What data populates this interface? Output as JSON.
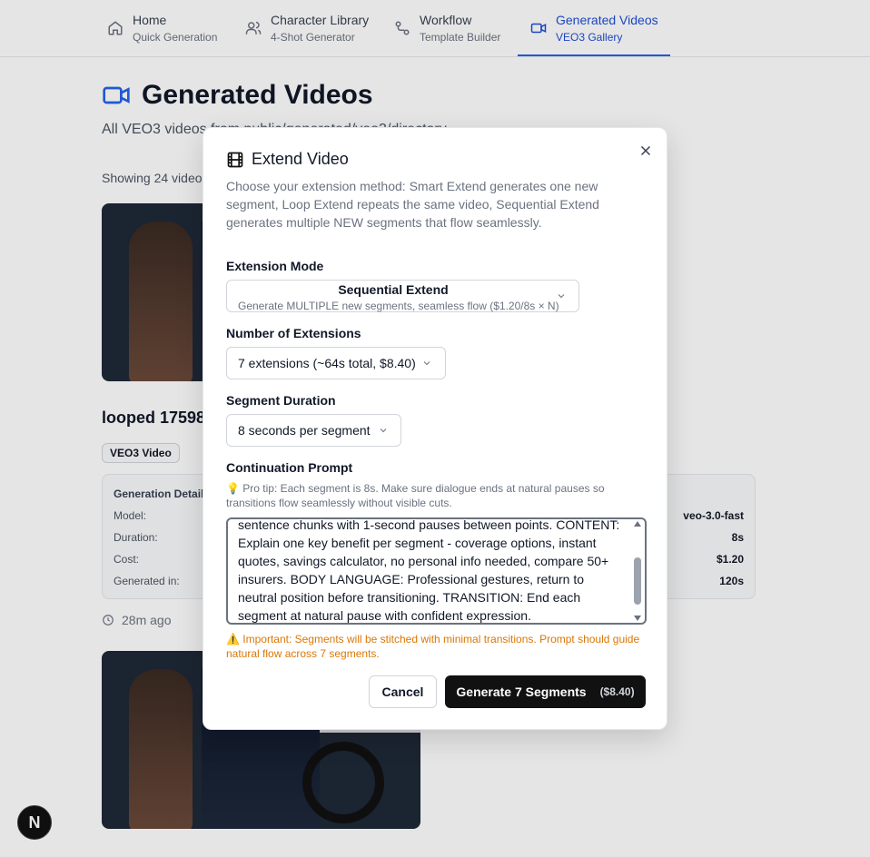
{
  "nav": {
    "items": [
      {
        "title": "Home",
        "subtitle": "Quick Generation",
        "icon": "home-icon"
      },
      {
        "title": "Character Library",
        "subtitle": "4-Shot Generator",
        "icon": "users-icon"
      },
      {
        "title": "Workflow",
        "subtitle": "Template Builder",
        "icon": "workflow-icon"
      },
      {
        "title": "Generated Videos",
        "subtitle": "VEO3 Gallery",
        "icon": "video-icon",
        "active": true
      }
    ]
  },
  "page": {
    "title": "Generated Videos",
    "subtitle": "All VEO3 videos from public/generated/veo3/directory",
    "showing": "Showing 24 videos",
    "video_title": "looped 1759827",
    "badge": "VEO3 Video",
    "details": {
      "heading": "Generation Details",
      "rows": [
        {
          "label": "Model:",
          "value": "veo-3.0-fast"
        },
        {
          "label": "Duration:",
          "value": "8s"
        },
        {
          "label": "Cost:",
          "value": "$1.20"
        },
        {
          "label": "Generated in:",
          "value": "120s"
        }
      ]
    },
    "ago": "28m ago",
    "next_logo": "N"
  },
  "modal": {
    "title": "Extend Video",
    "description": "Choose your extension method: Smart Extend generates one new segment, Loop Extend repeats the same video, Sequential Extend generates multiple NEW segments that flow seamlessly.",
    "mode_label": "Extension Mode",
    "mode_value": "Sequential Extend",
    "mode_hint": "Generate MULTIPLE new segments, seamless flow ($1.20/8s × N)",
    "num_label": "Number of Extensions",
    "num_value": "7 extensions (~64s total, $8.40)",
    "dur_label": "Segment Duration",
    "dur_value": "8 seconds per segment",
    "prompt_label": "Continuation Prompt",
    "tip": "💡  Pro tip: Each segment is 8s. Make sure dialogue ends at natural pauses so transitions flow seamlessly without visible cuts.",
    "prompt_text": "sentence chunks with 1-second pauses between points. CONTENT: Explain one key benefit per segment - coverage options, instant quotes, savings calculator, no personal info needed, compare 50+ insurers. BODY LANGUAGE: Professional gestures, return to neutral position before transitioning. TRANSITION: End each segment at natural pause with confident expression.",
    "warning": "⚠️  Important: Segments will be stitched with minimal transitions. Prompt should guide natural flow across 7 segments.",
    "cancel_label": "Cancel",
    "generate_label": "Generate 7 Segments",
    "generate_price": "($8.40)"
  }
}
